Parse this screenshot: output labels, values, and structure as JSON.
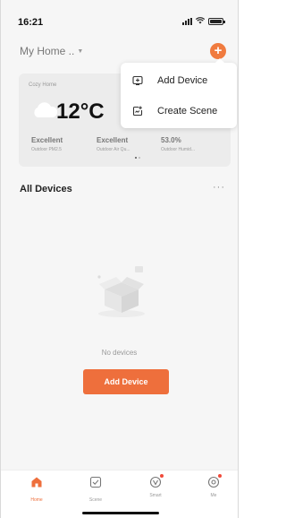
{
  "status_bar": {
    "time": "16:21"
  },
  "header": {
    "home_name": "My Home ..",
    "add_symbol": "+"
  },
  "weather": {
    "location": "Cozy Home",
    "temperature": "12°C",
    "metrics": [
      {
        "value": "Excellent",
        "label": "Outdoor PM2.5"
      },
      {
        "value": "Excellent",
        "label": "Outdoor Air Qu..."
      },
      {
        "value": "53.0%",
        "label": "Outdoor Humid..."
      }
    ]
  },
  "menu": {
    "items": [
      {
        "label": "Add Device",
        "icon": "add-device-icon"
      },
      {
        "label": "Create Scene",
        "icon": "create-scene-icon"
      }
    ]
  },
  "devices": {
    "title": "All Devices",
    "more": "···",
    "empty_text": "No devices",
    "add_button": "Add Device"
  },
  "tabs": [
    {
      "label": "Home",
      "icon": "home-icon",
      "active": true
    },
    {
      "label": "Scene",
      "icon": "scene-icon"
    },
    {
      "label": "Smart",
      "icon": "smart-icon",
      "badge": true
    },
    {
      "label": "Me",
      "icon": "me-icon",
      "badge": true
    }
  ],
  "colors": {
    "accent": "#ee6f3c",
    "badge": "#f04a3a"
  }
}
